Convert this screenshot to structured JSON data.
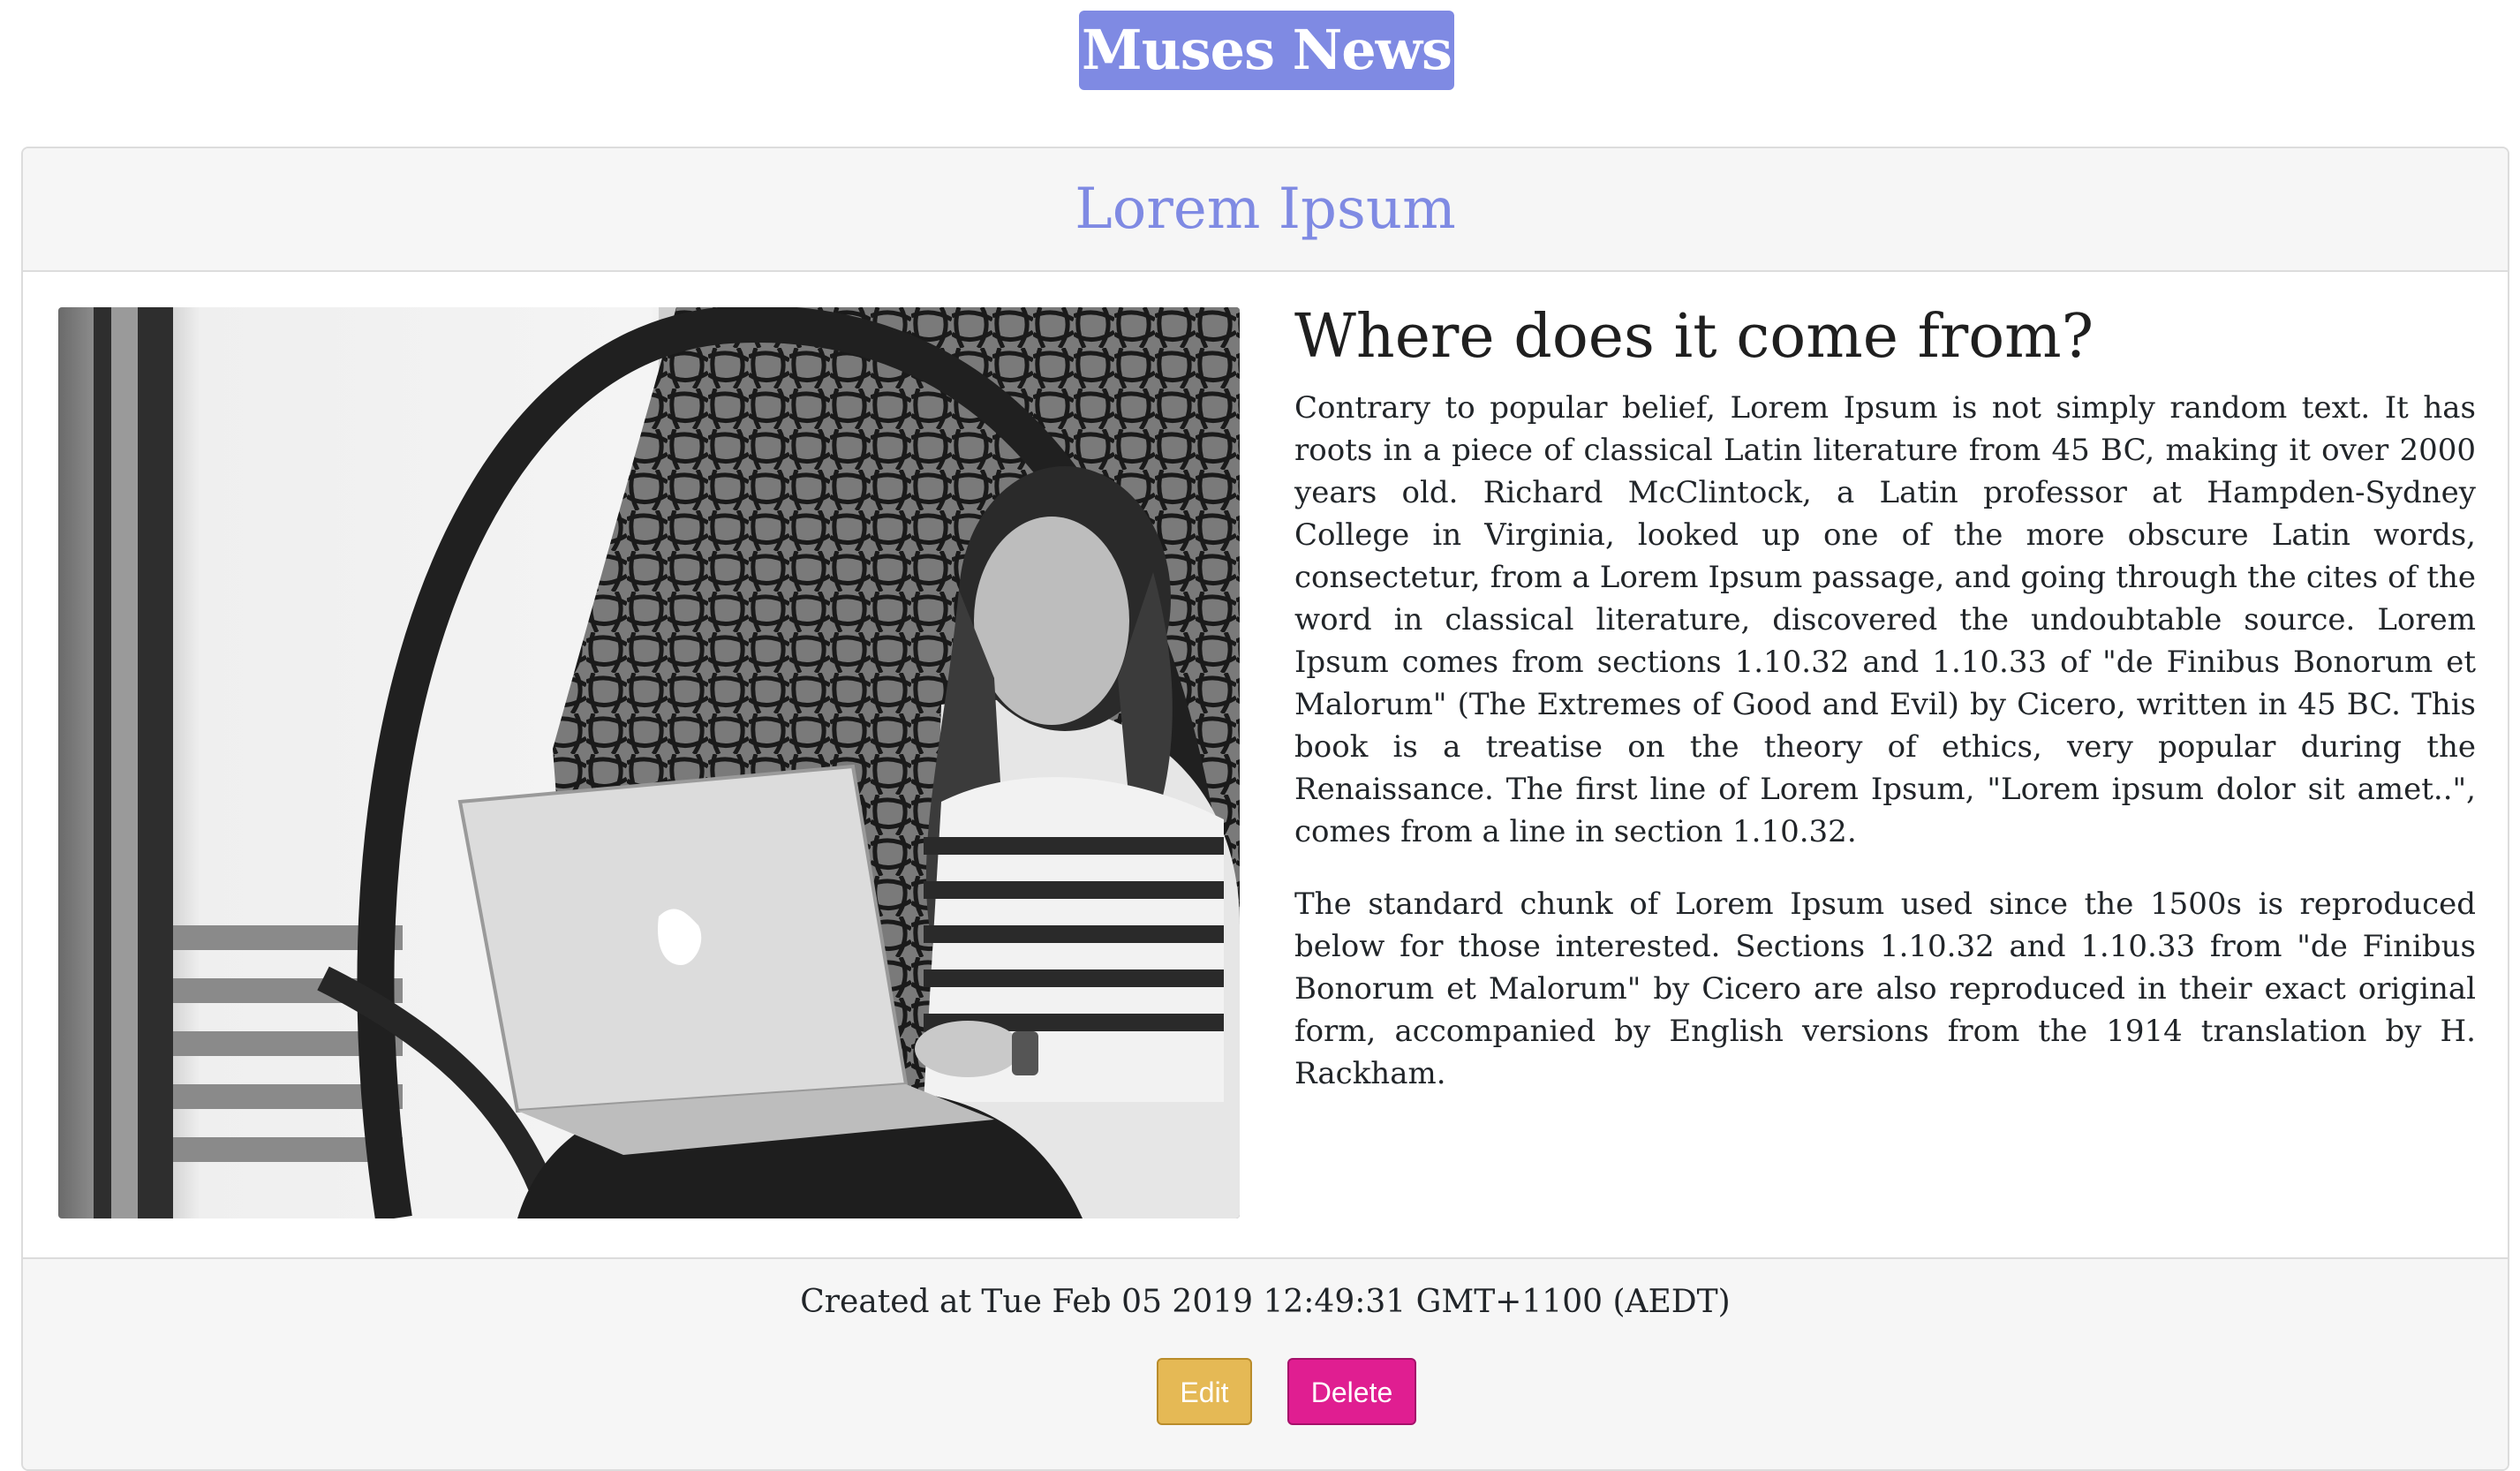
{
  "brand": {
    "name": "Muses News",
    "color": "#7f8ae3"
  },
  "post": {
    "title": "Lorem Ipsum",
    "heading": "Where does it come from?",
    "paragraphs": [
      "Contrary to popular belief, Lorem Ipsum is not simply random text. It has roots in a piece of classical Latin literature from 45 BC, making it over 2000 years old. Richard McClintock, a Latin professor at Hampden-Sydney College in Virginia, looked up one of the more obscure Latin words, consectetur, from a Lorem Ipsum passage, and going through the cites of the word in classical literature, discovered the undoubtable source. Lorem Ipsum comes from sections 1.10.32 and 1.10.33 of \"de Finibus Bonorum et Malorum\" (The Extremes of Good and Evil) by Cicero, written in 45 BC. This book is a treatise on the theory of ethics, very popular during the Renaissance. The first line of Lorem Ipsum, \"Lorem ipsum dolor sit amet..\", comes from a line in section 1.10.32.",
      "The standard chunk of Lorem Ipsum used since the 1500s is reproduced below for those interested. Sections 1.10.32 and 1.10.33 from \"de Finibus Bonorum et Malorum\" by Cicero are also reproduced in their exact original form, accompanied by English versions from the 1914 translation by H. Rackham."
    ],
    "created_at": "Created at Tue Feb 05 2019 12:49:31 GMT+1100 (AEDT)"
  },
  "actions": {
    "edit_label": "Edit",
    "delete_label": "Delete",
    "edit_color": "#e5b955",
    "delete_color": "#e01e91"
  }
}
